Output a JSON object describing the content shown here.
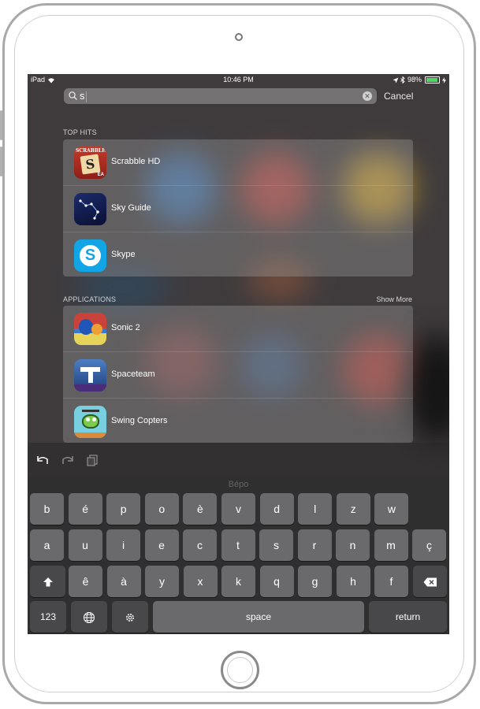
{
  "status_bar": {
    "device": "iPad",
    "time": "10:46 PM",
    "battery": "98%"
  },
  "search": {
    "query": "s",
    "cancel_label": "Cancel"
  },
  "top_hits": {
    "header": "TOP HITS",
    "items": [
      {
        "label": "Scrabble HD",
        "icon": "scrabble-app-icon"
      },
      {
        "label": "Sky Guide",
        "icon": "sky-guide-app-icon"
      },
      {
        "label": "Skype",
        "icon": "skype-app-icon"
      }
    ]
  },
  "applications": {
    "header": "APPLICATIONS",
    "show_more": "Show More",
    "items": [
      {
        "label": "Sonic 2",
        "icon": "sonic-app-icon"
      },
      {
        "label": "Spaceteam",
        "icon": "spaceteam-app-icon"
      },
      {
        "label": "Swing Copters",
        "icon": "swing-copters-app-icon"
      }
    ]
  },
  "keyboard": {
    "layout_name": "Bépo",
    "row1": [
      "b",
      "é",
      "p",
      "o",
      "è",
      "v",
      "d",
      "l",
      "z",
      "w"
    ],
    "row2": [
      "a",
      "u",
      "i",
      "e",
      "c",
      "t",
      "s",
      "r",
      "n",
      "m",
      "ç"
    ],
    "row3": [
      "ê",
      "à",
      "y",
      "x",
      "k",
      "q",
      "g",
      "h",
      "f"
    ],
    "numbers_label": "123",
    "space_label": "space",
    "return_label": "return"
  },
  "colors": {
    "accent": "#6fb1ff",
    "battery": "#4cd964"
  }
}
